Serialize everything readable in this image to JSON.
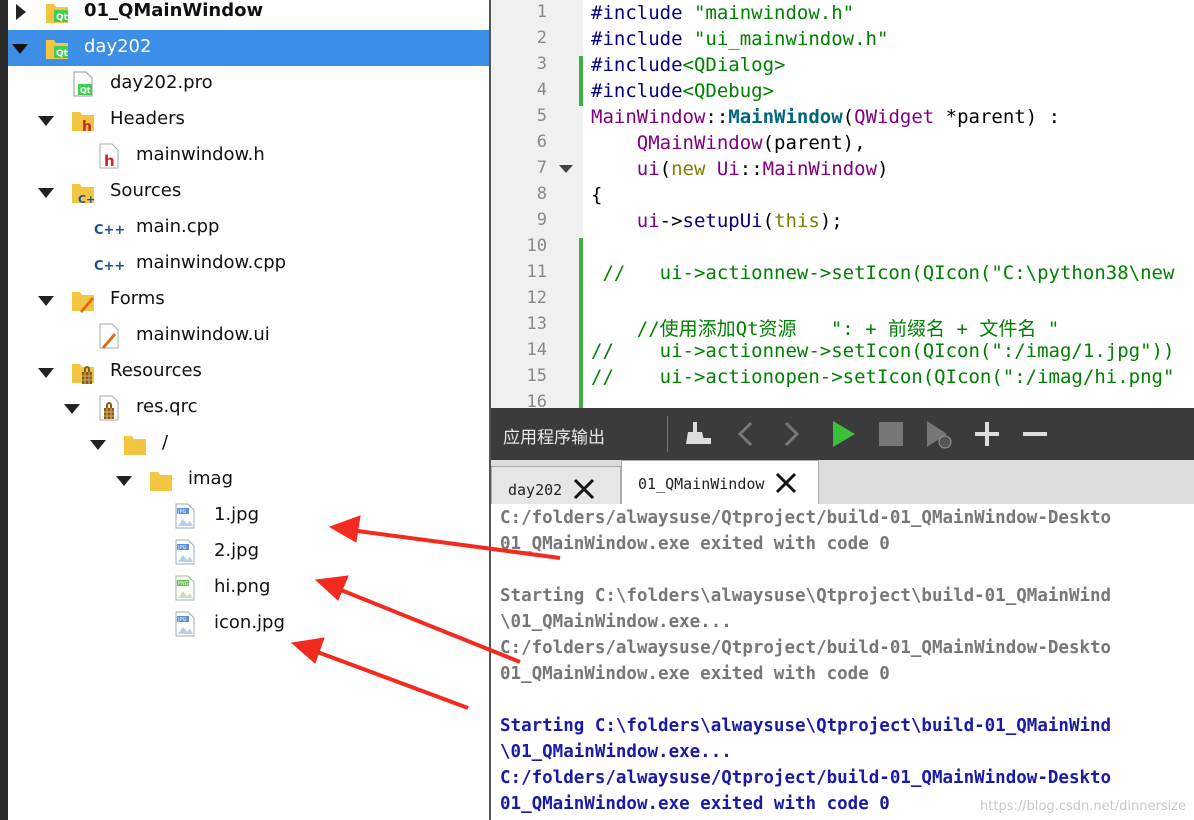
{
  "tree": {
    "items": [
      {
        "label": "01_QMainWindow",
        "icon": "qt-project-folder-icon"
      },
      {
        "label": "day202",
        "icon": "qt-project-folder-icon"
      },
      {
        "label": "day202.pro",
        "icon": "qt-pro-file-icon"
      },
      {
        "label": "Headers",
        "icon": "headers-folder-icon"
      },
      {
        "label": "mainwindow.h",
        "icon": "header-file-icon"
      },
      {
        "label": "Sources",
        "icon": "sources-folder-icon"
      },
      {
        "label": "main.cpp",
        "icon": "cpp-file-icon"
      },
      {
        "label": "mainwindow.cpp",
        "icon": "cpp-file-icon"
      },
      {
        "label": "Forms",
        "icon": "forms-folder-icon"
      },
      {
        "label": "mainwindow.ui",
        "icon": "ui-file-icon"
      },
      {
        "label": "Resources",
        "icon": "resources-folder-icon"
      },
      {
        "label": "res.qrc",
        "icon": "qrc-file-icon"
      },
      {
        "label": "/",
        "icon": "folder-icon"
      },
      {
        "label": "imag",
        "icon": "folder-icon"
      },
      {
        "label": "1.jpg",
        "icon": "jpg-file-icon"
      },
      {
        "label": "2.jpg",
        "icon": "jpg-file-icon"
      },
      {
        "label": "hi.png",
        "icon": "png-file-icon"
      },
      {
        "label": "icon.jpg",
        "icon": "jpg-file-icon"
      }
    ],
    "selected": "day202"
  },
  "editor": {
    "line_numbers": [
      "1",
      "2",
      "3",
      "4",
      "5",
      "6",
      "7",
      "8",
      "9",
      "10",
      "11",
      "12",
      "13",
      "14",
      "15",
      "16"
    ],
    "lines": [
      [
        {
          "t": "#include ",
          "c": "pp"
        },
        {
          "t": "\"mainwindow.h\"",
          "c": "str"
        }
      ],
      [
        {
          "t": "#include ",
          "c": "pp"
        },
        {
          "t": "\"ui_mainwindow.h\"",
          "c": "str"
        }
      ],
      [
        {
          "t": "#include",
          "c": "pp"
        },
        {
          "t": "<QDialog>",
          "c": "str"
        }
      ],
      [
        {
          "t": "#include",
          "c": "pp"
        },
        {
          "t": "<QDebug>",
          "c": "str"
        }
      ],
      [
        {
          "t": "MainWindow",
          "c": "ty"
        },
        {
          "t": "::",
          "c": "plain"
        },
        {
          "t": "MainWindow",
          "c": "fn"
        },
        {
          "t": "(",
          "c": "plain"
        },
        {
          "t": "QWidget",
          "c": "ty"
        },
        {
          "t": " *parent) :",
          "c": "plain"
        }
      ],
      [
        {
          "t": "    ",
          "c": "plain"
        },
        {
          "t": "QMainWindow",
          "c": "ty"
        },
        {
          "t": "(parent),",
          "c": "plain"
        }
      ],
      [
        {
          "t": "    ",
          "c": "plain"
        },
        {
          "t": "ui",
          "c": "ty"
        },
        {
          "t": "(",
          "c": "plain"
        },
        {
          "t": "new",
          "c": "kw"
        },
        {
          "t": " ",
          "c": "plain"
        },
        {
          "t": "Ui",
          "c": "ty"
        },
        {
          "t": "::",
          "c": "plain"
        },
        {
          "t": "MainWindow",
          "c": "ty"
        },
        {
          "t": ")",
          "c": "plain"
        }
      ],
      [
        {
          "t": "{",
          "c": "plain"
        }
      ],
      [
        {
          "t": "    ",
          "c": "plain"
        },
        {
          "t": "ui",
          "c": "ty"
        },
        {
          "t": "->",
          "c": "plain"
        },
        {
          "t": "setupUi",
          "c": "pp"
        },
        {
          "t": "(",
          "c": "plain"
        },
        {
          "t": "this",
          "c": "kw"
        },
        {
          "t": ");",
          "c": "plain"
        }
      ],
      [
        {
          "t": "",
          "c": "plain"
        }
      ],
      [
        {
          "t": " //   ui->actionnew->setIcon(QIcon(\"C:\\python38\\new",
          "c": "cm"
        }
      ],
      [
        {
          "t": "",
          "c": "plain"
        }
      ],
      [
        {
          "t": "    //使用添加Qt资源   \": + 前缀名 + 文件名 \"",
          "c": "cm"
        }
      ],
      [
        {
          "t": "//    ui->actionnew->setIcon(QIcon(\":/imag/1.jpg\"))",
          "c": "cm"
        }
      ],
      [
        {
          "t": "//    ui->actionopen->setIcon(QIcon(\":/imag/hi.png\"",
          "c": "cm"
        }
      ],
      [
        {
          "t": "",
          "c": "plain"
        }
      ]
    ]
  },
  "output": {
    "title": "应用程序输出",
    "tabs": [
      {
        "label": "day202"
      },
      {
        "label": "01_QMainWindow"
      }
    ],
    "active_tab": "01_QMainWindow",
    "lines": [
      {
        "text": "C:/folders/alwaysuse/Qtproject/build-01_QMainWindow-Deskto",
        "style": "gray"
      },
      {
        "text": "01_QMainWindow.exe exited with code 0",
        "style": "gray"
      },
      {
        "text": "",
        "style": "gray"
      },
      {
        "text": "Starting C:\\folders\\alwaysuse\\Qtproject\\build-01_QMainWind",
        "style": "gray"
      },
      {
        "text": "\\01_QMainWindow.exe...",
        "style": "gray"
      },
      {
        "text": "C:/folders/alwaysuse/Qtproject/build-01_QMainWindow-Deskto",
        "style": "gray"
      },
      {
        "text": "01_QMainWindow.exe exited with code 0",
        "style": "gray"
      },
      {
        "text": "",
        "style": "gray"
      },
      {
        "text": "Starting C:\\folders\\alwaysuse\\Qtproject\\build-01_QMainWind",
        "style": "blue"
      },
      {
        "text": "\\01_QMainWindow.exe...",
        "style": "blue"
      },
      {
        "text": "C:/folders/alwaysuse/Qtproject/build-01_QMainWindow-Deskto",
        "style": "blue"
      },
      {
        "text": "01_QMainWindow.exe exited with code 0",
        "style": "blue"
      }
    ],
    "watermark": "https://blog.csdn.net/dinnersize"
  },
  "colors": {
    "selection": "#3d8ee6",
    "annotation_arrow": "#f22a1f",
    "gutter_change": "#3cb043"
  }
}
